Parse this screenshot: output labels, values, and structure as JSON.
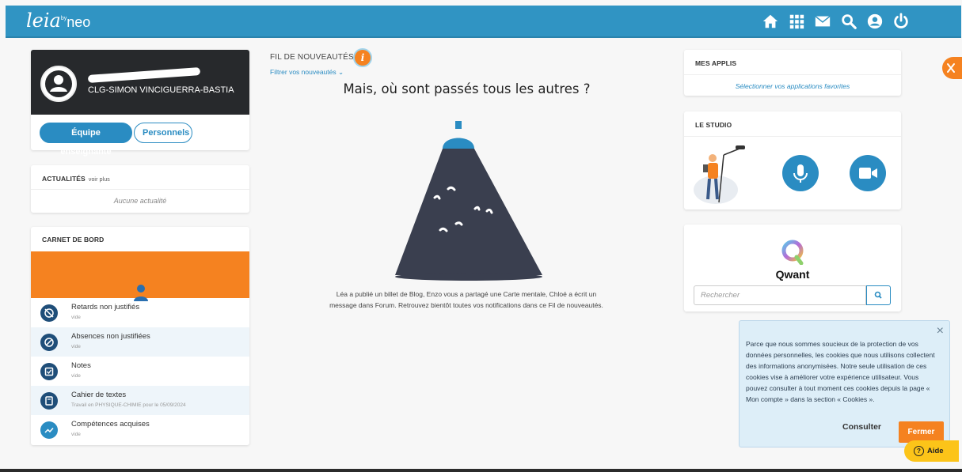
{
  "colors": {
    "topbar": "#3094c3",
    "accent_blue": "#2a8cc2",
    "accent_orange": "#f58220",
    "help_yellow": "#fcc419",
    "cookie_bg": "#ddeef8"
  },
  "topbar": {
    "logo": "leia",
    "logo_by": "by",
    "logo_neo": "neo",
    "icons": [
      "home-icon",
      "apps-grid-icon",
      "mail-icon",
      "search-icon",
      "user-icon",
      "power-icon"
    ]
  },
  "profile": {
    "school": "CLG-SIMON VINCIGUERRA-BASTIA",
    "team_button": "Équipe enseignante",
    "staff_button": "Personnels"
  },
  "actualites": {
    "title": "ACTUALITÉS",
    "more": "voir plus",
    "empty": "Aucune actualité"
  },
  "carnet": {
    "title": "CARNET DE BORD",
    "items": [
      {
        "label": "Retards non justifiés",
        "sub": "vide",
        "icon": "clock-off-icon"
      },
      {
        "label": "Absences non justifiées",
        "sub": "vide",
        "icon": "absence-icon"
      },
      {
        "label": "Notes",
        "sub": "vide",
        "icon": "notes-icon"
      },
      {
        "label": "Cahier de textes",
        "sub": "Travail en PHYSIQUE-CHIMIE pour le 05/09/2024",
        "icon": "book-icon"
      },
      {
        "label": "Compétences acquises",
        "sub": "vide",
        "icon": "trend-icon"
      }
    ]
  },
  "feed": {
    "title": "FIL DE NOUVEAUTÉS",
    "info": "i",
    "filter": "Filtrer vos nouveautés",
    "heading": "Mais, où sont passés tous les autres ?",
    "text": "Léa a publié un billet de Blog, Enzo vous a partagé une Carte mentale, Chloé a écrit un message dans Forum. Retrouvez bientôt toutes vos notifications dans ce Fil de nouveautés."
  },
  "applis": {
    "title": "MES APPLIS",
    "select": "Sélectionner vos applications favorites"
  },
  "studio": {
    "title": "LE STUDIO",
    "buttons": [
      "microphone-icon",
      "video-camera-icon"
    ]
  },
  "qwant": {
    "name": "Qwant",
    "placeholder": "Rechercher"
  },
  "cookie": {
    "text": "Parce que nous sommes soucieux de la protection de vos données personnelles, les cookies que nous utilisons collectent des informations anonymisées. Notre seule utilisation de ces cookies vise à améliorer votre expérience utilisateur. Vous pouvez consulter à tout moment ces cookies depuis la page « Mon compte » dans la section « Cookies ».",
    "consult": "Consulter",
    "close": "Fermer",
    "close_x": "×"
  },
  "help": {
    "label": "Aide",
    "q": "?"
  }
}
